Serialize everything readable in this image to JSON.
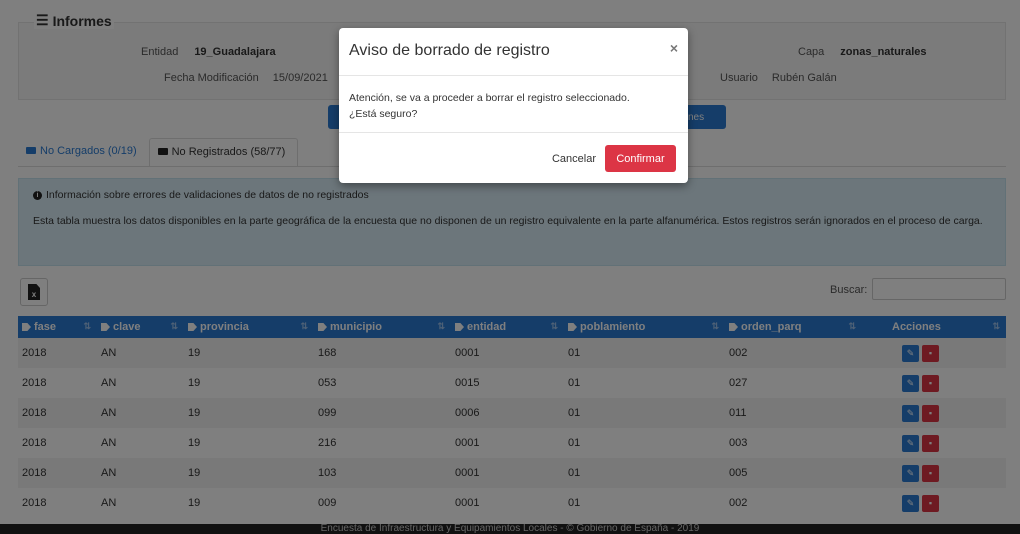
{
  "panel": {
    "title": "Informes",
    "entidad_label": "Entidad",
    "entidad_value": "19_Guadalajara",
    "capa_label": "Capa",
    "capa_value": "zonas_naturales",
    "fecha_label": "Fecha Modificación",
    "fecha_value": "15/09/2021",
    "usuario_label": "Usuario",
    "usuario_value": "Rubén Galán"
  },
  "buttons_behind": {
    "right_label": "nes"
  },
  "tabs": [
    {
      "label": "No Cargados (0/19)"
    },
    {
      "label": "No Registrados (58/77)"
    }
  ],
  "info": {
    "title": "Información sobre errores de validaciones de datos de no registrados",
    "text": "Esta tabla muestra los datos disponibles en la parte geográfica de la encuesta que no disponen de un registro equivalente en la parte alfanumérica. Estos registros serán ignorados en el proceso de carga."
  },
  "search": {
    "label": "Buscar:"
  },
  "table": {
    "headers": [
      "fase",
      "clave",
      "provincia",
      "municipio",
      "entidad",
      "poblamiento",
      "orden_parq",
      "Acciones"
    ],
    "rows": [
      [
        "2018",
        "AN",
        "19",
        "168",
        "0001",
        "01",
        "002"
      ],
      [
        "2018",
        "AN",
        "19",
        "053",
        "0015",
        "01",
        "027"
      ],
      [
        "2018",
        "AN",
        "19",
        "099",
        "0006",
        "01",
        "011"
      ],
      [
        "2018",
        "AN",
        "19",
        "216",
        "0001",
        "01",
        "003"
      ],
      [
        "2018",
        "AN",
        "19",
        "103",
        "0001",
        "01",
        "005"
      ],
      [
        "2018",
        "AN",
        "19",
        "009",
        "0001",
        "01",
        "002"
      ]
    ]
  },
  "footer": {
    "text": "Encuesta de Infraestructura y Equipamientos Locales - © Gobierno de España - 2019"
  },
  "modal": {
    "title": "Aviso de borrado de registro",
    "close": "×",
    "line1": "Atención, se va a proceder a borrar el registro seleccionado.",
    "line2": "¿Está seguro?",
    "cancel": "Cancelar",
    "confirm": "Confirmar"
  },
  "colors": {
    "primary": "#2a7bd3",
    "danger": "#dc3545",
    "info_bg": "#d9edf7"
  }
}
